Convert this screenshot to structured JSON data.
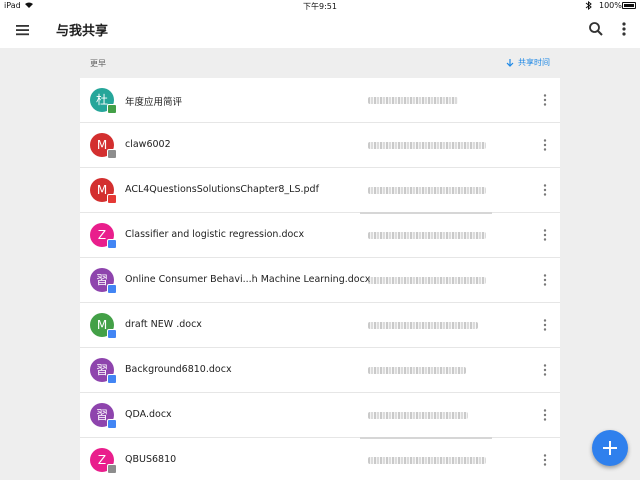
{
  "status_bar": {
    "device": "iPad",
    "time": "下午9:51",
    "battery": "100%"
  },
  "app_bar": {
    "title": "与我共享"
  },
  "section": {
    "label": "更早",
    "sort_label": "共享时间"
  },
  "files": [
    {
      "name": "年度应用简评",
      "avatar_letter": "杜",
      "avatar_color": "#26a69a",
      "badge": "shared",
      "badge_color": "#43a047"
    },
    {
      "name": "claw6002",
      "avatar_letter": "M",
      "avatar_color": "#d32f2f",
      "badge": "folder",
      "badge_color": "#8d8d8d"
    },
    {
      "name": "ACL4QuestionsSolutionsChapter8_LS.pdf",
      "avatar_letter": "M",
      "avatar_color": "#d32f2f",
      "badge": "pdf",
      "badge_color": "#e53935"
    },
    {
      "name": "Classifier and logistic regression.docx",
      "avatar_letter": "Z",
      "avatar_color": "#e91e8c",
      "badge": "doc",
      "badge_color": "#4285f4"
    },
    {
      "name": "Online Consumer Behavi...h Machine Learning.docx",
      "avatar_letter": "習",
      "avatar_color": "#8e44ad",
      "badge": "doc",
      "badge_color": "#4285f4"
    },
    {
      "name": "draft NEW .docx",
      "avatar_letter": "M",
      "avatar_color": "#43a047",
      "badge": "doc",
      "badge_color": "#4285f4"
    },
    {
      "name": "Background6810.docx",
      "avatar_letter": "習",
      "avatar_color": "#8e44ad",
      "badge": "doc",
      "badge_color": "#4285f4"
    },
    {
      "name": "QDA.docx",
      "avatar_letter": "習",
      "avatar_color": "#8e44ad",
      "badge": "doc",
      "badge_color": "#4285f4"
    },
    {
      "name": "QBUS6810",
      "avatar_letter": "Z",
      "avatar_color": "#e91e8c",
      "badge": "folder",
      "badge_color": "#8d8d8d"
    }
  ],
  "icons": {
    "menu": "hamburger-icon",
    "search": "search-icon",
    "more": "more-vert-icon",
    "sort": "arrow-down-icon",
    "fab": "plus-icon"
  },
  "colors": {
    "accent": "#1e88e5",
    "fab": "#2f80ed"
  }
}
